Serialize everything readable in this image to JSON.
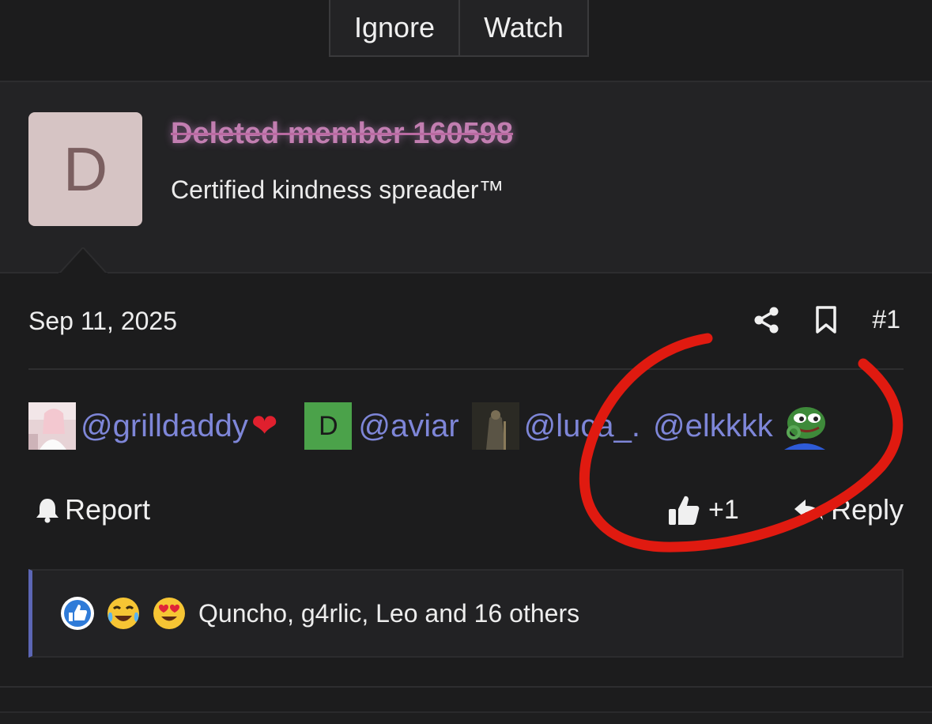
{
  "topbar": {
    "ignore_label": "Ignore",
    "watch_label": "Watch"
  },
  "user": {
    "avatar_letter": "D",
    "name": "Deleted member 160598",
    "title": "Certified kindness spreader™"
  },
  "post": {
    "date": "Sep 11, 2025",
    "number": "#1",
    "mentions": [
      {
        "text": "@grilldaddy"
      },
      {
        "text": "@aviar",
        "avatar_letter": "D"
      },
      {
        "text": "@luca_."
      },
      {
        "text": "@elkkkk"
      }
    ],
    "report_label": "Report",
    "like_label": "+1",
    "reply_label": "Reply",
    "reactions_text": "Quncho, g4rlic, Leo and 16 others"
  },
  "colors": {
    "background": "#1c1c1d",
    "mention": "#7e86d8",
    "reaction_bar_accent": "#5c66b5",
    "annotation": "#e01a10"
  }
}
